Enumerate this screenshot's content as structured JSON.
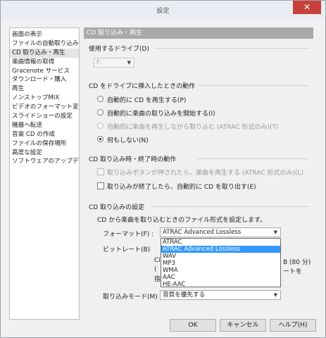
{
  "window": {
    "title": "設定",
    "close_glyph": "✕"
  },
  "sidebar": {
    "items": [
      "画面の表示",
      "ファイルの自動取り込み",
      "CD 取り込み・再生",
      "楽曲情報の取得",
      "Gracenote サービス",
      "ダウンロード・購入",
      "再生",
      "ノンストップMIX",
      "ビデオのフォーマット変換",
      "スライドショーの設定",
      "機器へ転送",
      "音楽 CD の作成",
      "ファイルの保存場所",
      "高度な設定",
      "ソフトウェアのアップデート"
    ],
    "selected_index": 2
  },
  "panel": {
    "header": "CD 取り込み・再生",
    "drive": {
      "label": "使用するドライブ(D)",
      "value": "F:"
    },
    "insert_section": {
      "title": "CD をドライブに挿入したときの動作",
      "options": [
        "自動的に CD を再生する(P)",
        "自動的に楽曲の取り込みを開始する(I)",
        "自動的に楽曲を再生しながら取り込む (ATRAC 形式のみ)(T)",
        "何もしない(N)"
      ],
      "selected_index": 3,
      "disabled_index": 2
    },
    "end_section": {
      "title": "CD 取り込み時・終了時の動作",
      "check1": "取り込みボタンが押されたら、楽曲を再生する (ATRAC 形式のみ)(L)",
      "check2": "取り込みが終了したら、自動的に CD を取り出す(E)"
    },
    "import_section": {
      "title": "CD 取り込みの設定",
      "desc": "CD から楽曲を取り込むときのファイル形式を設定します。",
      "format_label": "フォーマット(F) :",
      "format_value": "ATRAC Advanced Lossless",
      "bitrate_label": "ビットレート(B)",
      "bitrate_hidden_text": "Ci",
      "bitrate_tail": "B (80 分)",
      "note_paren": "(",
      "note_tail": "ートを",
      "note_line2": "指",
      "format_options": [
        "ATRAC",
        "ATRAC Advanced Lossless",
        "WAV",
        "MP3",
        "WMA",
        "AAC",
        "HE-AAC"
      ],
      "format_highlight_index": 1,
      "mode_label": "取り込みモード(M) :",
      "mode_value": "音質を優先する"
    }
  },
  "buttons": {
    "ok": "OK",
    "cancel": "キャンセル",
    "help": "ヘルプ(H)"
  }
}
